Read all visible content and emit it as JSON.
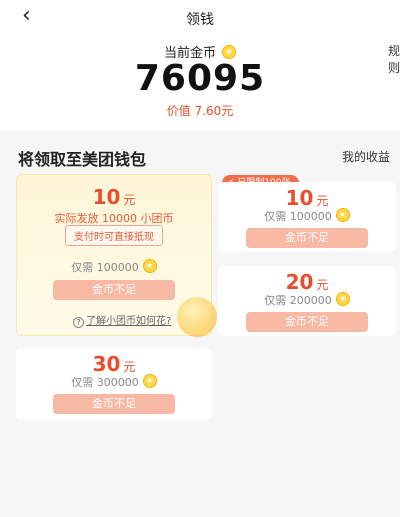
{
  "header": {
    "back_icon": "‹",
    "title": "领钱"
  },
  "hero": {
    "coin_label": "当前金币",
    "rules_label": "规则",
    "balance": "76095",
    "worth": "价值 7.60元"
  },
  "section": {
    "title": "将领取至美团钱包",
    "my_earnings": "我的收益"
  },
  "featured": {
    "amount": "10",
    "unit": "元",
    "desc": "实际发放 10000 小团币",
    "pill": "支付时可直接抵现",
    "need": "仅需 100000",
    "button": "金币不足",
    "help": "了解小团币如何花?"
  },
  "limit_badge": "日限制100张",
  "cards": [
    {
      "amount": "10",
      "unit": "元",
      "need": "仅需 100000",
      "button": "金币不足"
    },
    {
      "amount": "20",
      "unit": "元",
      "need": "仅需 200000",
      "button": "金币不足"
    },
    {
      "amount": "30",
      "unit": "元",
      "need": "仅需 300000",
      "button": "金币不足"
    }
  ]
}
